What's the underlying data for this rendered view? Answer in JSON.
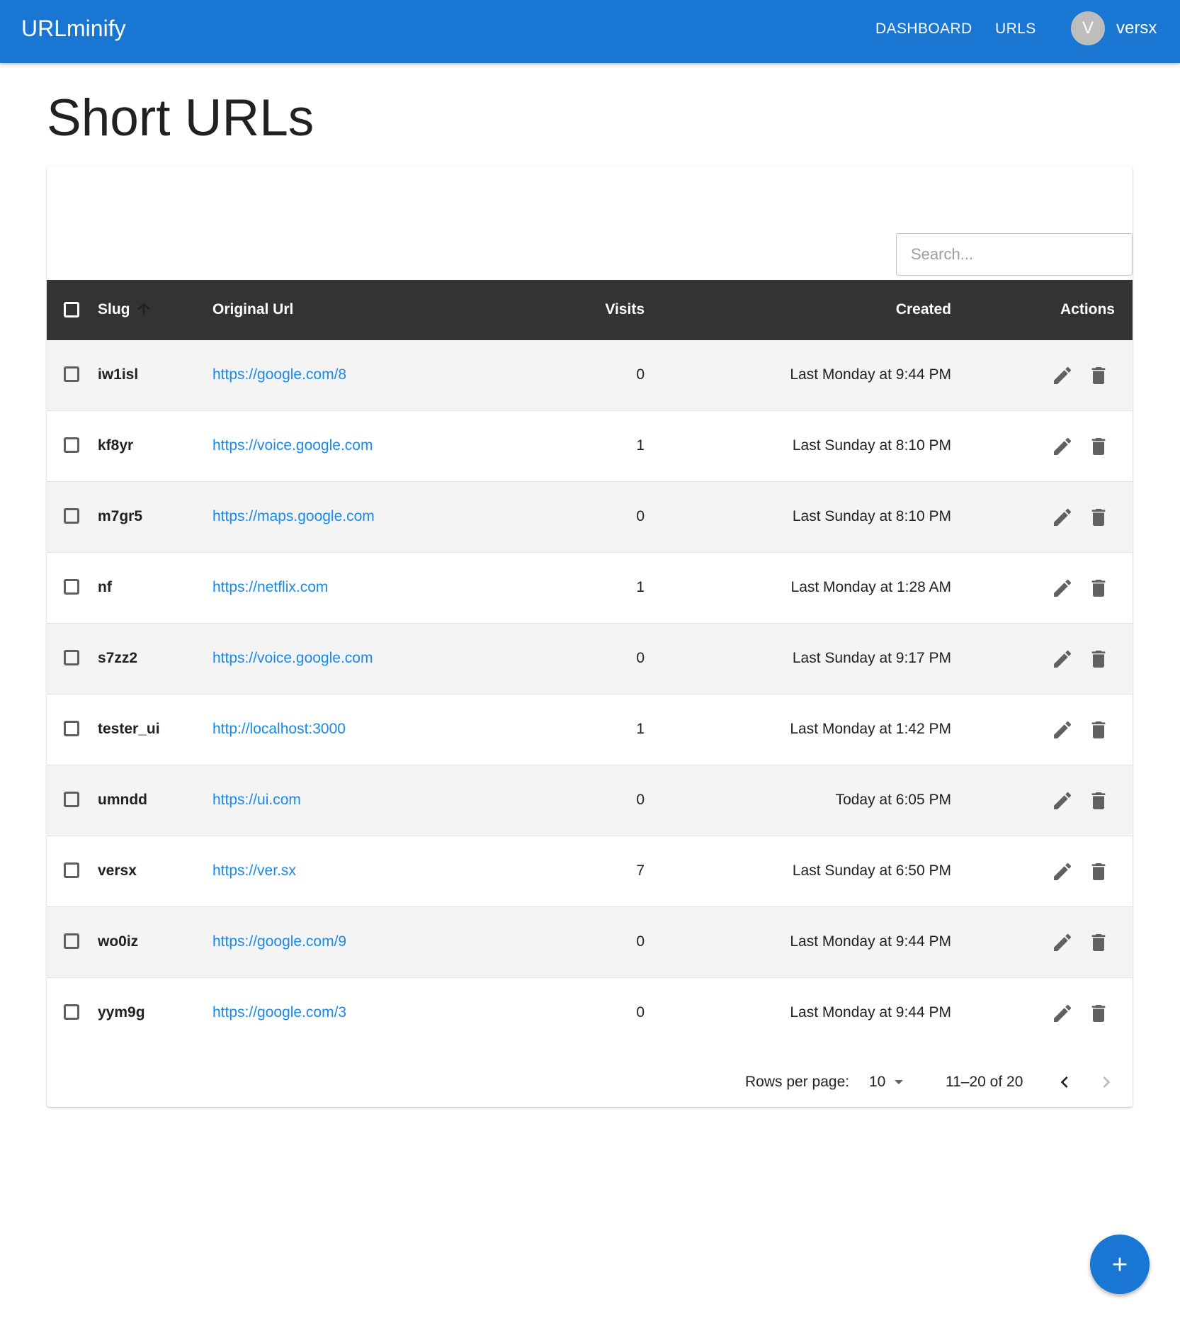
{
  "appbar": {
    "brand": "URLminify",
    "nav": [
      "DASHBOARD",
      "URLS"
    ],
    "user": {
      "avatar_letter": "V",
      "name": "versx"
    }
  },
  "page": {
    "title": "Short URLs"
  },
  "search": {
    "placeholder": "Search..."
  },
  "table": {
    "columns": [
      "Slug",
      "Original Url",
      "Visits",
      "Created",
      "Actions"
    ],
    "sorted_by": "Slug",
    "sort_direction": "ascending",
    "rows": [
      {
        "slug": "iw1isl",
        "url": "https://google.com/8",
        "visits": "0",
        "created": "Last Monday at 9:44 PM"
      },
      {
        "slug": "kf8yr",
        "url": "https://voice.google.com",
        "visits": "1",
        "created": "Last Sunday at 8:10 PM"
      },
      {
        "slug": "m7gr5",
        "url": "https://maps.google.com",
        "visits": "0",
        "created": "Last Sunday at 8:10 PM"
      },
      {
        "slug": "nf",
        "url": "https://netflix.com",
        "visits": "1",
        "created": "Last Monday at 1:28 AM"
      },
      {
        "slug": "s7zz2",
        "url": "https://voice.google.com",
        "visits": "0",
        "created": "Last Sunday at 9:17 PM"
      },
      {
        "slug": "tester_ui",
        "url": "http://localhost:3000",
        "visits": "1",
        "created": "Last Monday at 1:42 PM"
      },
      {
        "slug": "umndd",
        "url": "https://ui.com",
        "visits": "0",
        "created": "Today at 6:05 PM"
      },
      {
        "slug": "versx",
        "url": "https://ver.sx",
        "visits": "7",
        "created": "Last Sunday at 6:50 PM"
      },
      {
        "slug": "wo0iz",
        "url": "https://google.com/9",
        "visits": "0",
        "created": "Last Monday at 9:44 PM"
      },
      {
        "slug": "yym9g",
        "url": "https://google.com/3",
        "visits": "0",
        "created": "Last Monday at 9:44 PM"
      }
    ]
  },
  "pagination": {
    "rows_per_page_label": "Rows per page:",
    "rows_per_page": "10",
    "range": "11–20 of 20"
  },
  "colors": {
    "primary": "#1976d2",
    "link": "#1e88e5",
    "header_bg": "#333333",
    "stripe": "#f4f4f4"
  },
  "icons": {
    "row_actions": [
      "pencil-icon",
      "trash-icon"
    ],
    "pagination": [
      "chevron-left-icon",
      "chevron-right-icon"
    ],
    "fab": "plus-icon"
  }
}
